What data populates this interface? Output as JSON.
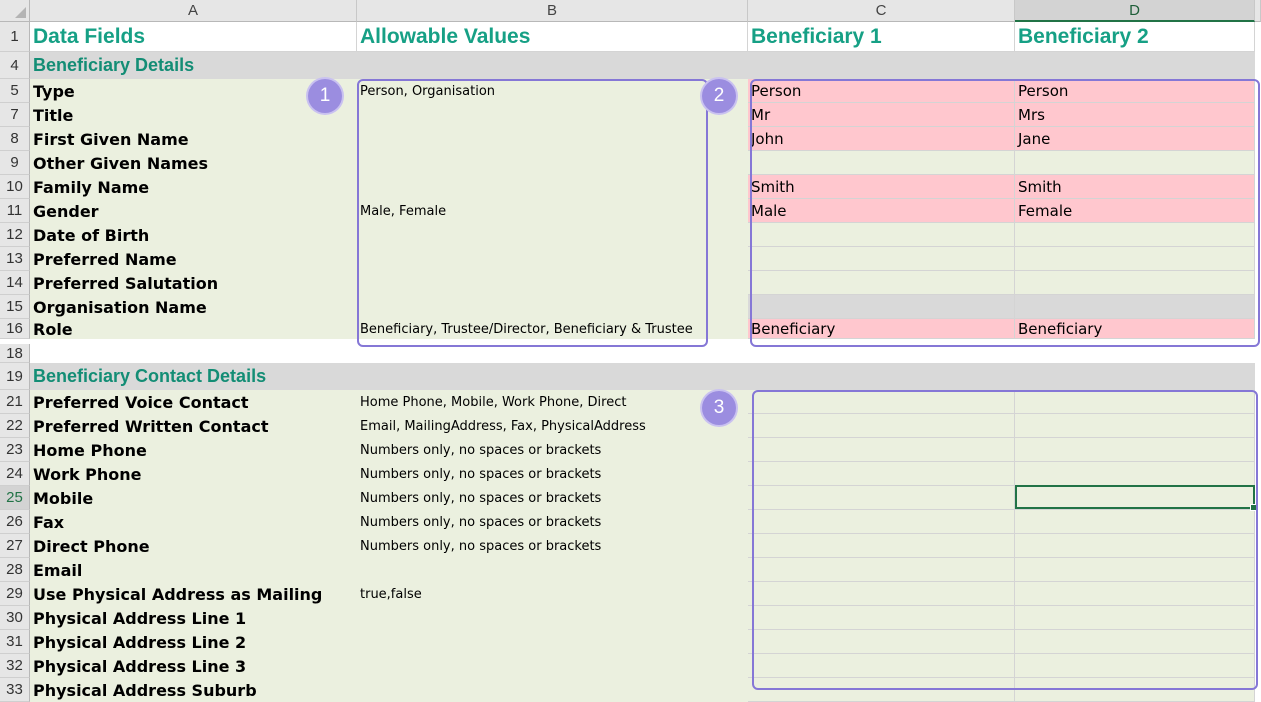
{
  "columns": [
    "A",
    "B",
    "C",
    "D"
  ],
  "selected_column": "D",
  "selected_row": "25",
  "header_row": {
    "num": "1",
    "a": "Data Fields",
    "b": "Allowable Values",
    "c": "Beneficiary 1",
    "d": "Beneficiary 2"
  },
  "sections": [
    {
      "num": "4",
      "title": "Beneficiary Details"
    },
    {
      "num": "19",
      "title": "Beneficiary Contact Details"
    }
  ],
  "details_rows": [
    {
      "num": "5",
      "field": "Type",
      "allowed": "Person, Organisation",
      "b1": "Person",
      "b2": "Person"
    },
    {
      "num": "7",
      "field": "Title",
      "allowed": "",
      "b1": "Mr",
      "b2": "Mrs"
    },
    {
      "num": "8",
      "field": "First Given Name",
      "allowed": "",
      "b1": "John",
      "b2": "Jane"
    },
    {
      "num": "9",
      "field": "Other Given Names",
      "allowed": "",
      "b1": "",
      "b2": ""
    },
    {
      "num": "10",
      "field": "Family Name",
      "allowed": "",
      "b1": "Smith",
      "b2": "Smith"
    },
    {
      "num": "11",
      "field": "Gender",
      "allowed": "Male, Female",
      "b1": "Male",
      "b2": "Female"
    },
    {
      "num": "12",
      "field": "Date of Birth",
      "allowed": "",
      "b1": "",
      "b2": ""
    },
    {
      "num": "13",
      "field": "Preferred Name",
      "allowed": "",
      "b1": "",
      "b2": ""
    },
    {
      "num": "14",
      "field": "Preferred Salutation",
      "allowed": "",
      "b1": "",
      "b2": ""
    },
    {
      "num": "15",
      "field": "Organisation Name",
      "allowed": "",
      "b1": "",
      "b2": ""
    },
    {
      "num": "16",
      "field": "Role",
      "allowed": "Beneficiary, Trustee/Director, Beneficiary & Trustee",
      "b1": "Beneficiary",
      "b2": "Beneficiary"
    }
  ],
  "blank_row": {
    "num": "18"
  },
  "contact_rows": [
    {
      "num": "21",
      "field": "Preferred Voice Contact",
      "allowed": "Home Phone, Mobile, Work Phone, Direct"
    },
    {
      "num": "22",
      "field": "Preferred Written Contact",
      "allowed": "Email, MailingAddress, Fax, PhysicalAddress"
    },
    {
      "num": "23",
      "field": "Home Phone",
      "allowed": "Numbers only, no spaces or brackets"
    },
    {
      "num": "24",
      "field": "Work Phone",
      "allowed": "Numbers only, no spaces or brackets"
    },
    {
      "num": "25",
      "field": "Mobile",
      "allowed": "Numbers only, no spaces or brackets"
    },
    {
      "num": "26",
      "field": "Fax",
      "allowed": "Numbers only, no spaces or brackets"
    },
    {
      "num": "27",
      "field": "Direct Phone",
      "allowed": "Numbers only, no spaces or brackets"
    },
    {
      "num": "28",
      "field": "Email",
      "allowed": ""
    },
    {
      "num": "29",
      "field": "Use Physical Address as Mailing",
      "allowed": "true,false"
    },
    {
      "num": "30",
      "field": "Physical Address Line 1",
      "allowed": ""
    },
    {
      "num": "31",
      "field": "Physical Address Line 2",
      "allowed": ""
    },
    {
      "num": "32",
      "field": "Physical Address Line 3",
      "allowed": ""
    },
    {
      "num": "33",
      "field": "Physical Address Suburb",
      "allowed": ""
    }
  ],
  "badges": [
    "1",
    "2",
    "3"
  ],
  "colors": {
    "header_text": "#16a085",
    "section_text": "#138d75",
    "field_bg": "#ebf0df",
    "section_bg": "#d9d9d9",
    "highlight_bg": "#ffc7ce",
    "frame": "#8577d6",
    "selection": "#217346"
  }
}
